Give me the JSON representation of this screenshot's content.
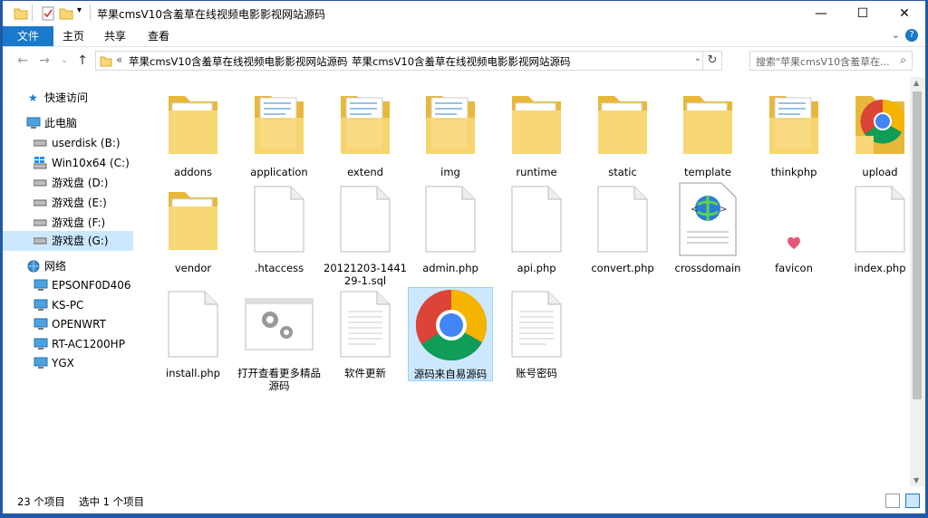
{
  "window": {
    "title": "苹果cmsV10含羞草在线视频电影影视网站源码",
    "controls": {
      "minimize": "—",
      "maximize": "☐",
      "close": "✕"
    }
  },
  "ribbon": {
    "tabs": [
      "文件",
      "主页",
      "共享",
      "查看"
    ],
    "expand_icon": "chevron-down-icon",
    "help_icon": "help-icon"
  },
  "address": {
    "prefix": "«",
    "crumbs": [
      "苹果cmsV10含羞草在线视频电影影视网站源码",
      "苹果cmsV10含羞草在线视频电影影视网站源码"
    ],
    "separator": "›",
    "search_placeholder": "搜索\"苹果cmsV10含羞草在..."
  },
  "nav": {
    "quick_access": "快速访问",
    "this_pc": "此电脑",
    "drives": [
      "userdisk (B:)",
      "Win10x64 (C:)",
      "游戏盘 (D:)",
      "游戏盘 (E:)",
      "游戏盘 (F:)",
      "游戏盘 (G:)"
    ],
    "network": "网络",
    "hosts": [
      "EPSONF0D406",
      "KS-PC",
      "OPENWRT",
      "RT-AC1200HP",
      "YGX"
    ]
  },
  "files": [
    {
      "name": "addons",
      "kind": "folder"
    },
    {
      "name": "application",
      "kind": "folder-docs"
    },
    {
      "name": "extend",
      "kind": "folder-docs"
    },
    {
      "name": "img",
      "kind": "folder-docs"
    },
    {
      "name": "runtime",
      "kind": "folder"
    },
    {
      "name": "static",
      "kind": "folder"
    },
    {
      "name": "template",
      "kind": "folder"
    },
    {
      "name": "thinkphp",
      "kind": "folder-docs"
    },
    {
      "name": "upload",
      "kind": "folder-chrome"
    },
    {
      "name": "vendor",
      "kind": "folder"
    },
    {
      "name": ".htaccess",
      "kind": "file"
    },
    {
      "name": "20121203-144129-1.sql",
      "kind": "file"
    },
    {
      "name": "admin.php",
      "kind": "file"
    },
    {
      "name": "api.php",
      "kind": "file"
    },
    {
      "name": "convert.php",
      "kind": "file"
    },
    {
      "name": "crossdomain",
      "kind": "xml"
    },
    {
      "name": "favicon",
      "kind": "favicon"
    },
    {
      "name": "index.php",
      "kind": "file"
    },
    {
      "name": "install.php",
      "kind": "file"
    },
    {
      "name": "打开查看更多精品源码",
      "kind": "settings"
    },
    {
      "name": "软件更新",
      "kind": "text"
    },
    {
      "name": "源码来自易源码",
      "kind": "chrome",
      "selected": true
    },
    {
      "name": "账号密码",
      "kind": "text"
    }
  ],
  "status": {
    "count": "23 个项目",
    "selected": "选中 1 个项目"
  },
  "colors": {
    "accent": "#1979ca",
    "selection": "#cce8ff",
    "folder": "#f8d775"
  }
}
